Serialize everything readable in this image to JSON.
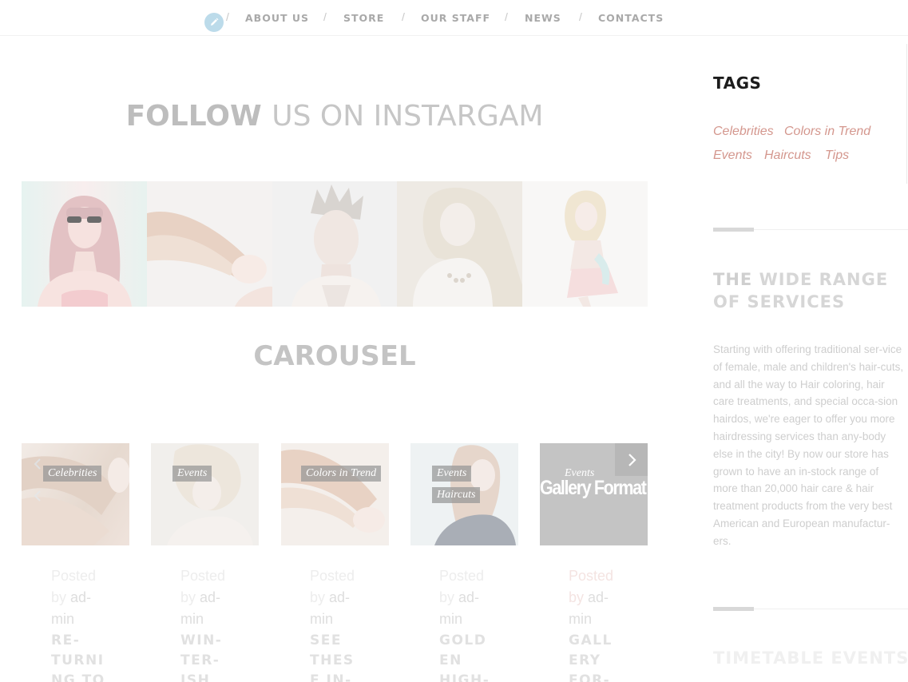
{
  "nav": {
    "items": [
      {
        "label": "ABOUT US"
      },
      {
        "label": "STORE"
      },
      {
        "label": "OUR STAFF"
      },
      {
        "label": "NEWS"
      },
      {
        "label": "CONTACTS"
      }
    ],
    "separator": "/",
    "edit_icon": "pencil-icon"
  },
  "instagram": {
    "title_strong": "FOLLOW",
    "title_light": "US ON INSTARGAM"
  },
  "carousel": {
    "title": "CAROUSEL",
    "prev_icon": "chevron-left-icon",
    "next_icon": "chevron-right-icon",
    "cards": [
      {
        "tags": [
          "Celebrities"
        ],
        "posted": "Posted",
        "by": "by",
        "author_lines": [
          "ad-",
          "min"
        ],
        "title_lines": [
          "RE-",
          "TURNI",
          "NG TO"
        ]
      },
      {
        "tags": [
          "Events"
        ],
        "posted": "Posted",
        "by": "by",
        "author_lines": [
          "ad-",
          "min"
        ],
        "title_lines": [
          "WIN-",
          "TER-",
          "ISH"
        ]
      },
      {
        "tags": [
          "Colors in Trend"
        ],
        "posted": "Posted",
        "by": "by",
        "author_lines": [
          "ad-",
          "min"
        ],
        "title_lines": [
          "SEE",
          "THES",
          "E IN-"
        ]
      },
      {
        "tags": [
          "Events",
          "Haircuts"
        ],
        "posted": "Posted",
        "by": "by",
        "author_lines": [
          "ad-",
          "min"
        ],
        "title_lines": [
          "GOLD",
          "EN",
          "HIGH-"
        ]
      },
      {
        "tags": [
          "Events"
        ],
        "overlay_text": "Gallery Format",
        "posted": "Posted",
        "by": "by",
        "author_lines": [
          "ad-",
          "min"
        ],
        "title_lines": [
          "GALL",
          "ERY",
          "FOR-"
        ]
      }
    ]
  },
  "sidebar": {
    "tags_heading": "TAGS",
    "tags": [
      "Celebrities",
      "Colors in Trend",
      "Events",
      "Haircuts",
      "Tips"
    ],
    "services_title_strong": "THE",
    "services_title_light": "WIDE RANGE OF SERVICES",
    "services_body": "Starting with offering traditional ser-vice of female, male and children's hair-cuts, and all the way to Hair coloring, hair care treatments, and special occa-sion hairdos, we're eager to offer you more hairdressing services than any-body else in the city! By now our store has grown to have an in-stock range of more than 20,000 hair care & hair treatment products from the very best American and European manufactur-ers.",
    "timetable_title": "TIMETABLE EVENTS"
  },
  "colors": {
    "accent": "#d4978e",
    "edit_badge": "#bcdbea",
    "heading_dark": "#1c1c1c"
  }
}
